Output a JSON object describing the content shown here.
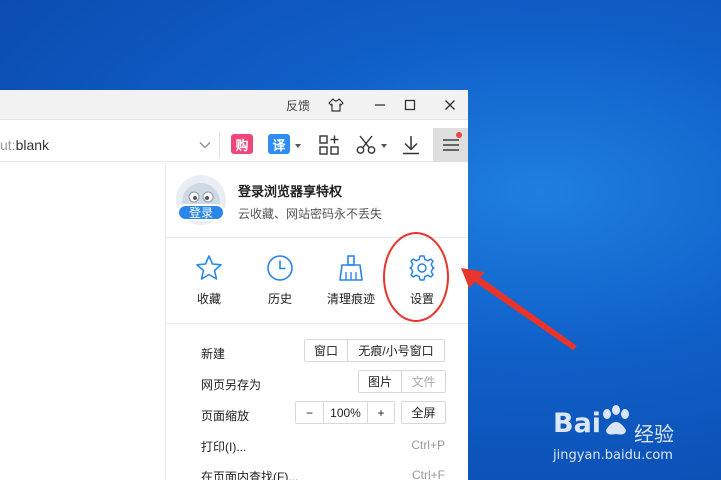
{
  "titlebar": {
    "feedback_label": "反馈",
    "icons": [
      "skin-icon",
      "minimize-icon",
      "maximize-icon",
      "close-icon"
    ]
  },
  "toolbar": {
    "address_dim": "ut:",
    "address_value": "blank",
    "shopping_badge": "购",
    "translate_badge": "译",
    "icons": [
      "apps-icon",
      "scissors-icon",
      "download-icon",
      "menu-icon"
    ]
  },
  "panel": {
    "login_badge": "登录",
    "login_title": "登录浏览器享特权",
    "login_subtitle": "云收藏、网站密码永不丢失",
    "quick_actions": [
      {
        "label": "收藏",
        "icon": "star-icon"
      },
      {
        "label": "历史",
        "icon": "clock-icon"
      },
      {
        "label": "清理痕迹",
        "icon": "broom-icon"
      },
      {
        "label": "设置",
        "icon": "gear-icon"
      }
    ],
    "menu": {
      "new_label": "新建",
      "new_window": "窗口",
      "new_private": "无痕/小号窗口",
      "saveas_label": "网页另存为",
      "saveas_image": "图片",
      "saveas_file": "文件",
      "zoom_label": "页面缩放",
      "zoom_minus": "−",
      "zoom_value": "100%",
      "zoom_plus": "+",
      "fullscreen": "全屏",
      "print_label": "打印(I)...",
      "print_shortcut": "Ctrl+P",
      "find_label": "在页面内查找(F)...",
      "find_shortcut": "Ctrl+F"
    }
  },
  "colors": {
    "accent": "#2a86e8",
    "annotation": "#e8342a",
    "desktop": "#0f5fc8",
    "shopping": "#f2457a",
    "translate": "#2b8ef0"
  },
  "watermark": {
    "brand": "Bai",
    "product": "经验",
    "url": "jingyan.baidu.com"
  }
}
